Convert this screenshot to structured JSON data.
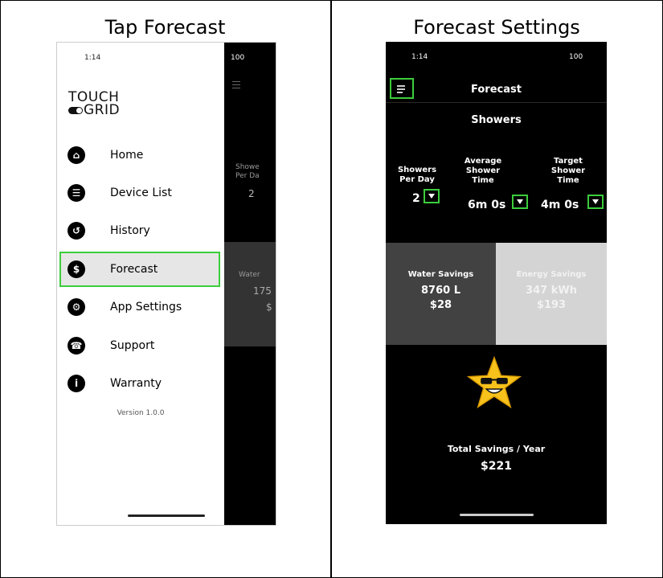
{
  "left_panel": {
    "title": "Tap Forecast",
    "status_time": "1:14",
    "logo_top": "TOUCH",
    "logo_bottom": "GRID",
    "menu": [
      {
        "label": "Home",
        "icon": "home-icon",
        "glyph": "⌂"
      },
      {
        "label": "Device List",
        "icon": "list-icon",
        "glyph": "☰"
      },
      {
        "label": "History",
        "icon": "history-icon",
        "glyph": "↺"
      },
      {
        "label": "Forecast",
        "icon": "dollar-icon",
        "glyph": "$"
      },
      {
        "label": "App Settings",
        "icon": "gear-icon",
        "glyph": "⚙"
      },
      {
        "label": "Support",
        "icon": "support-icon",
        "glyph": "☎"
      },
      {
        "label": "Warranty",
        "icon": "info-icon",
        "glyph": "i"
      }
    ],
    "version": "Version 1.0.0",
    "peek": {
      "status": "100",
      "showers_label_1": "Showe",
      "showers_label_2": "Per Da",
      "showers_value": "2",
      "water_label": "Water",
      "water_value": "175",
      "water_money": "$"
    }
  },
  "right_panel": {
    "title": "Forecast Settings",
    "status_time": "1:14",
    "status_right": "100",
    "screen_title": "Forecast",
    "section": "Showers",
    "params": [
      {
        "label": "Showers Per Day",
        "value": "2"
      },
      {
        "label": "Average Shower Time",
        "value": "6m 0s"
      },
      {
        "label": "Target Shower Time",
        "value": "4m 0s"
      }
    ],
    "water_savings": {
      "label": "Water Savings",
      "amount": "8760 L",
      "money": "$28"
    },
    "energy_savings": {
      "label": "Energy Savings",
      "amount": "347 kWh",
      "money": "$193"
    },
    "total_label": "Total Savings / Year",
    "total_value": "$221"
  },
  "colors": {
    "highlight": "#3ccd3c",
    "water_bg": "#424242",
    "energy_bg": "#d4d4d4",
    "energy_text": "#f2f2f2"
  }
}
